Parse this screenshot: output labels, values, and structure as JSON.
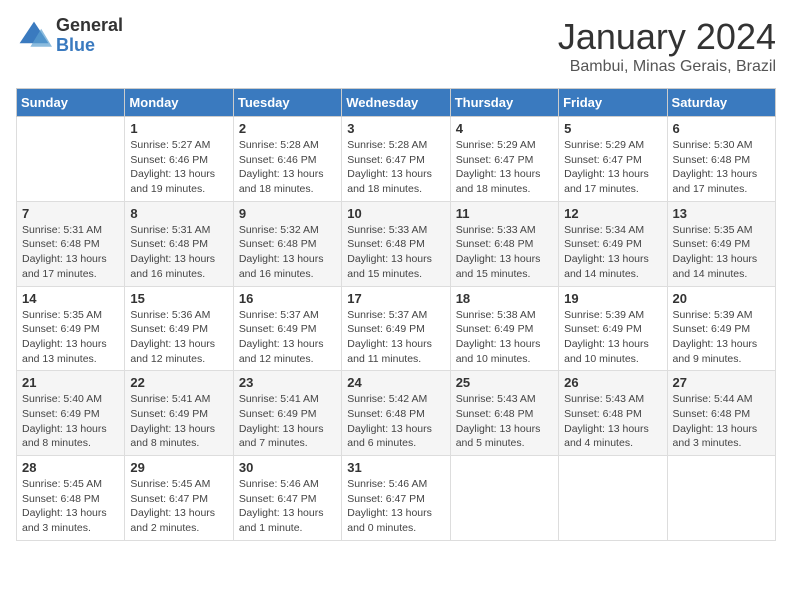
{
  "logo": {
    "general": "General",
    "blue": "Blue"
  },
  "title": "January 2024",
  "location": "Bambui, Minas Gerais, Brazil",
  "weekdays": [
    "Sunday",
    "Monday",
    "Tuesday",
    "Wednesday",
    "Thursday",
    "Friday",
    "Saturday"
  ],
  "weeks": [
    [
      {
        "day": "",
        "info": ""
      },
      {
        "day": "1",
        "info": "Sunrise: 5:27 AM\nSunset: 6:46 PM\nDaylight: 13 hours\nand 19 minutes."
      },
      {
        "day": "2",
        "info": "Sunrise: 5:28 AM\nSunset: 6:46 PM\nDaylight: 13 hours\nand 18 minutes."
      },
      {
        "day": "3",
        "info": "Sunrise: 5:28 AM\nSunset: 6:47 PM\nDaylight: 13 hours\nand 18 minutes."
      },
      {
        "day": "4",
        "info": "Sunrise: 5:29 AM\nSunset: 6:47 PM\nDaylight: 13 hours\nand 18 minutes."
      },
      {
        "day": "5",
        "info": "Sunrise: 5:29 AM\nSunset: 6:47 PM\nDaylight: 13 hours\nand 17 minutes."
      },
      {
        "day": "6",
        "info": "Sunrise: 5:30 AM\nSunset: 6:48 PM\nDaylight: 13 hours\nand 17 minutes."
      }
    ],
    [
      {
        "day": "7",
        "info": "Sunrise: 5:31 AM\nSunset: 6:48 PM\nDaylight: 13 hours\nand 17 minutes."
      },
      {
        "day": "8",
        "info": "Sunrise: 5:31 AM\nSunset: 6:48 PM\nDaylight: 13 hours\nand 16 minutes."
      },
      {
        "day": "9",
        "info": "Sunrise: 5:32 AM\nSunset: 6:48 PM\nDaylight: 13 hours\nand 16 minutes."
      },
      {
        "day": "10",
        "info": "Sunrise: 5:33 AM\nSunset: 6:48 PM\nDaylight: 13 hours\nand 15 minutes."
      },
      {
        "day": "11",
        "info": "Sunrise: 5:33 AM\nSunset: 6:48 PM\nDaylight: 13 hours\nand 15 minutes."
      },
      {
        "day": "12",
        "info": "Sunrise: 5:34 AM\nSunset: 6:49 PM\nDaylight: 13 hours\nand 14 minutes."
      },
      {
        "day": "13",
        "info": "Sunrise: 5:35 AM\nSunset: 6:49 PM\nDaylight: 13 hours\nand 14 minutes."
      }
    ],
    [
      {
        "day": "14",
        "info": "Sunrise: 5:35 AM\nSunset: 6:49 PM\nDaylight: 13 hours\nand 13 minutes."
      },
      {
        "day": "15",
        "info": "Sunrise: 5:36 AM\nSunset: 6:49 PM\nDaylight: 13 hours\nand 12 minutes."
      },
      {
        "day": "16",
        "info": "Sunrise: 5:37 AM\nSunset: 6:49 PM\nDaylight: 13 hours\nand 12 minutes."
      },
      {
        "day": "17",
        "info": "Sunrise: 5:37 AM\nSunset: 6:49 PM\nDaylight: 13 hours\nand 11 minutes."
      },
      {
        "day": "18",
        "info": "Sunrise: 5:38 AM\nSunset: 6:49 PM\nDaylight: 13 hours\nand 10 minutes."
      },
      {
        "day": "19",
        "info": "Sunrise: 5:39 AM\nSunset: 6:49 PM\nDaylight: 13 hours\nand 10 minutes."
      },
      {
        "day": "20",
        "info": "Sunrise: 5:39 AM\nSunset: 6:49 PM\nDaylight: 13 hours\nand 9 minutes."
      }
    ],
    [
      {
        "day": "21",
        "info": "Sunrise: 5:40 AM\nSunset: 6:49 PM\nDaylight: 13 hours\nand 8 minutes."
      },
      {
        "day": "22",
        "info": "Sunrise: 5:41 AM\nSunset: 6:49 PM\nDaylight: 13 hours\nand 8 minutes."
      },
      {
        "day": "23",
        "info": "Sunrise: 5:41 AM\nSunset: 6:49 PM\nDaylight: 13 hours\nand 7 minutes."
      },
      {
        "day": "24",
        "info": "Sunrise: 5:42 AM\nSunset: 6:48 PM\nDaylight: 13 hours\nand 6 minutes."
      },
      {
        "day": "25",
        "info": "Sunrise: 5:43 AM\nSunset: 6:48 PM\nDaylight: 13 hours\nand 5 minutes."
      },
      {
        "day": "26",
        "info": "Sunrise: 5:43 AM\nSunset: 6:48 PM\nDaylight: 13 hours\nand 4 minutes."
      },
      {
        "day": "27",
        "info": "Sunrise: 5:44 AM\nSunset: 6:48 PM\nDaylight: 13 hours\nand 3 minutes."
      }
    ],
    [
      {
        "day": "28",
        "info": "Sunrise: 5:45 AM\nSunset: 6:48 PM\nDaylight: 13 hours\nand 3 minutes."
      },
      {
        "day": "29",
        "info": "Sunrise: 5:45 AM\nSunset: 6:47 PM\nDaylight: 13 hours\nand 2 minutes."
      },
      {
        "day": "30",
        "info": "Sunrise: 5:46 AM\nSunset: 6:47 PM\nDaylight: 13 hours\nand 1 minute."
      },
      {
        "day": "31",
        "info": "Sunrise: 5:46 AM\nSunset: 6:47 PM\nDaylight: 13 hours\nand 0 minutes."
      },
      {
        "day": "",
        "info": ""
      },
      {
        "day": "",
        "info": ""
      },
      {
        "day": "",
        "info": ""
      }
    ]
  ]
}
